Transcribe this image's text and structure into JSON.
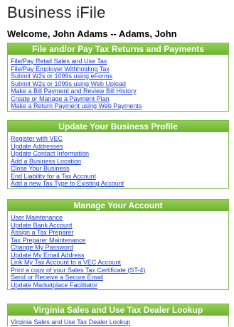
{
  "page": {
    "title": "Business iFile",
    "welcome": "Welcome, John Adams -- Adams, John"
  },
  "colors": {
    "header_green": "#7cc142",
    "link_blue": "#1a3dd6"
  },
  "sections": [
    {
      "heading": "File and/or Pay Tax Returns and Payments",
      "links": [
        "File/Pay Retail Sales and Use Tax",
        "File/Pay Employer Withholding Tax",
        "Submit W2s or 1099s using eForms",
        "Submit W2s or 1099s using Web Upload",
        "Make a Bill Payment and Review Bill History",
        "Create or Manage a Payment Plan",
        "Make a Return Payment using Web Payments"
      ]
    },
    {
      "heading": "Update Your Business Profile",
      "links": [
        "Register with VEC",
        "Update Addresses",
        "Update Contact Information",
        "Add a Business Location",
        "Close Your Business",
        "End Liability for a Tax Account",
        "Add a new Tax Type to Existing Account"
      ]
    },
    {
      "heading": "Manage Your Account",
      "links": [
        "User Maintenance",
        "Update Bank Account",
        "Assign a Tax Preparer",
        "Tax Preparer Maintenance",
        "Change My Password",
        "Update My Email Address",
        "Link My Tax Account to a VEC Account",
        "Print a copy of your Sales Tax Certificate (ST-4)",
        "Send or Receive a Secure Email",
        "Update Marketplace Facilitator"
      ]
    },
    {
      "heading": "Virginia Sales and Use Tax Dealer Lookup",
      "links": [
        "Virginia Sales and Use Tax Dealer Lookup"
      ]
    }
  ]
}
